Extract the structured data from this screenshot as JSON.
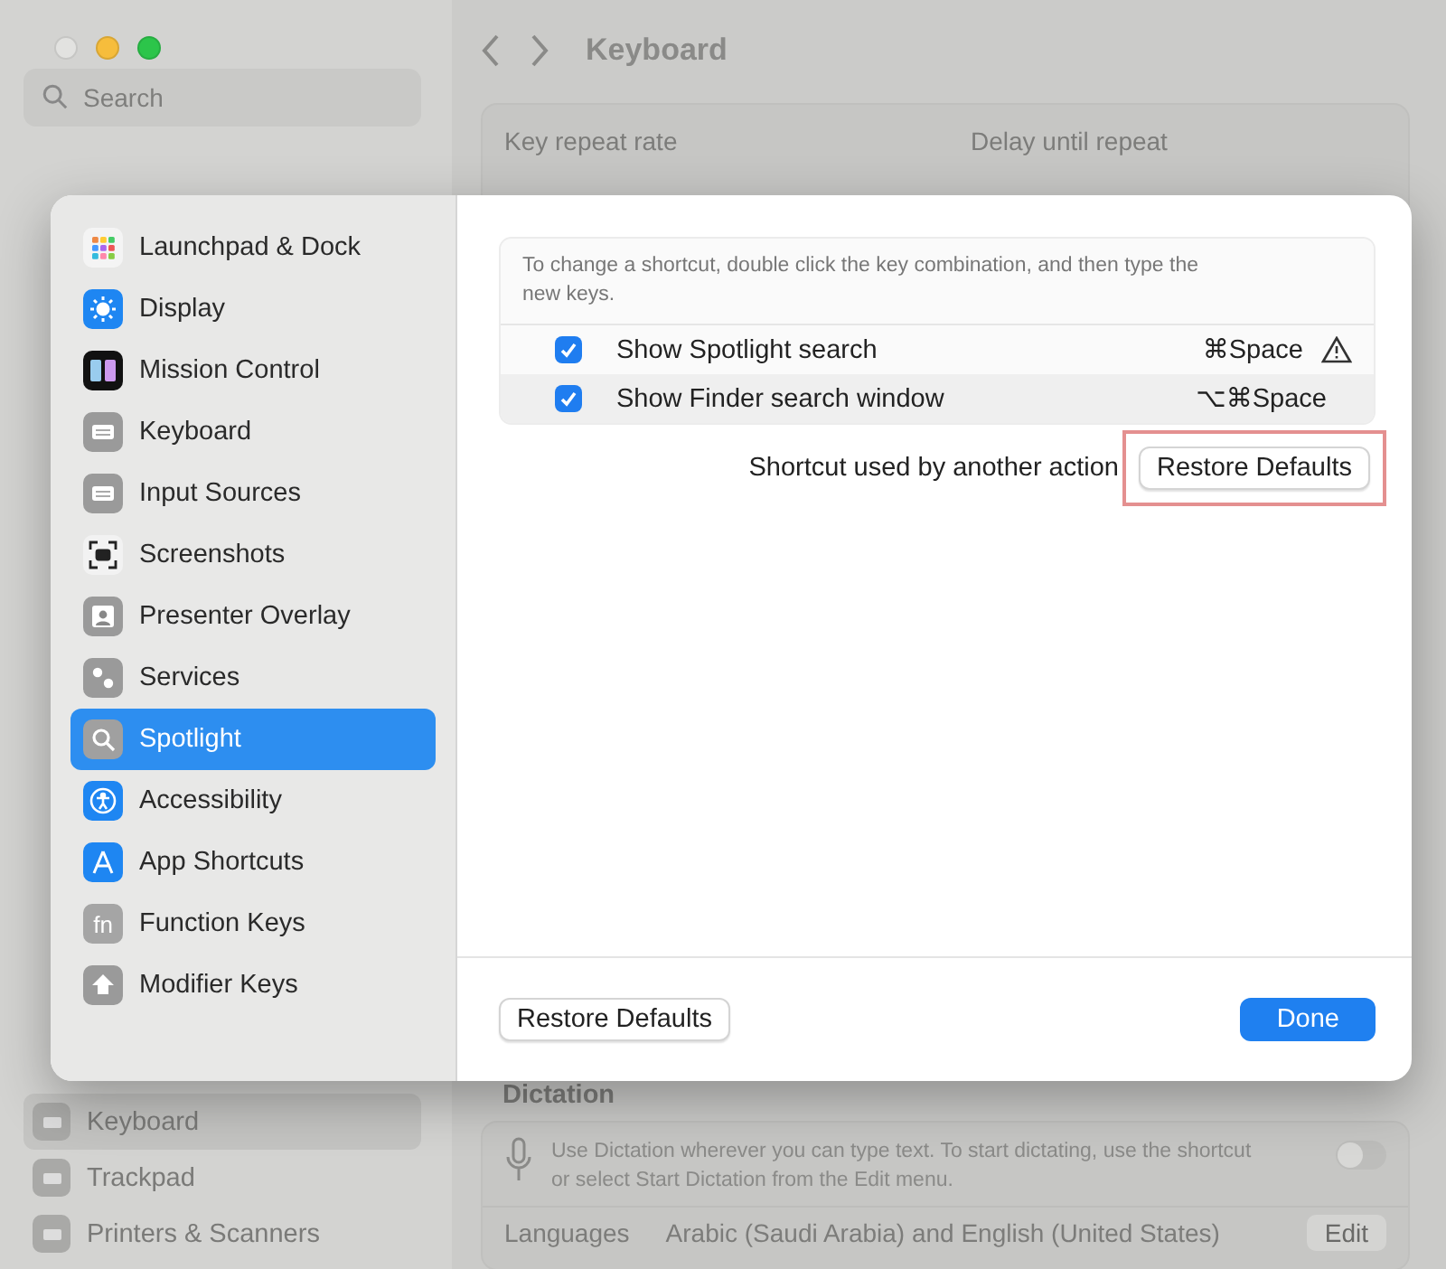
{
  "sidebar": {
    "search": {
      "placeholder": "Search"
    },
    "items": [
      {
        "label": "Keyboard",
        "selected": true
      },
      {
        "label": "Trackpad",
        "selected": false
      },
      {
        "label": "Printers & Scanners",
        "selected": false
      }
    ]
  },
  "page": {
    "title": "Keyboard",
    "key_repeat": {
      "label": "Key repeat rate"
    },
    "delay": {
      "label": "Delay until repeat"
    },
    "dictation": {
      "heading": "Dictation",
      "description": "Use Dictation wherever you can type text. To start dictating, use the shortcut or select Start Dictation from the Edit menu.",
      "on": false
    },
    "languages": {
      "label": "Languages",
      "value": "Arabic (Saudi Arabia) and English (United States)",
      "button": "Edit"
    }
  },
  "dialog": {
    "categories": [
      {
        "label": "Launchpad & Dock",
        "selected": false
      },
      {
        "label": "Display",
        "selected": false
      },
      {
        "label": "Mission Control",
        "selected": false
      },
      {
        "label": "Keyboard",
        "selected": false
      },
      {
        "label": "Input Sources",
        "selected": false
      },
      {
        "label": "Screenshots",
        "selected": false
      },
      {
        "label": "Presenter Overlay",
        "selected": false
      },
      {
        "label": "Services",
        "selected": false
      },
      {
        "label": "Spotlight",
        "selected": true
      },
      {
        "label": "Accessibility",
        "selected": false
      },
      {
        "label": "App Shortcuts",
        "selected": false
      },
      {
        "label": "Function Keys",
        "selected": false,
        "icon_text": "fn"
      },
      {
        "label": "Modifier Keys",
        "selected": false
      }
    ],
    "hint": "To change a shortcut, double click the key combination, and then type the new keys.",
    "shortcuts": [
      {
        "label": "Show Spotlight search",
        "keys": "⌘Space",
        "checked": true,
        "conflict": true
      },
      {
        "label": "Show Finder search window",
        "keys": "⌥⌘Space",
        "checked": true,
        "conflict": false
      }
    ],
    "conflict_message": "Shortcut used by another action",
    "restore_button": "Restore Defaults",
    "highlighted": true,
    "footer": {
      "restore_button": "Restore Defaults",
      "done_button": "Done"
    }
  }
}
